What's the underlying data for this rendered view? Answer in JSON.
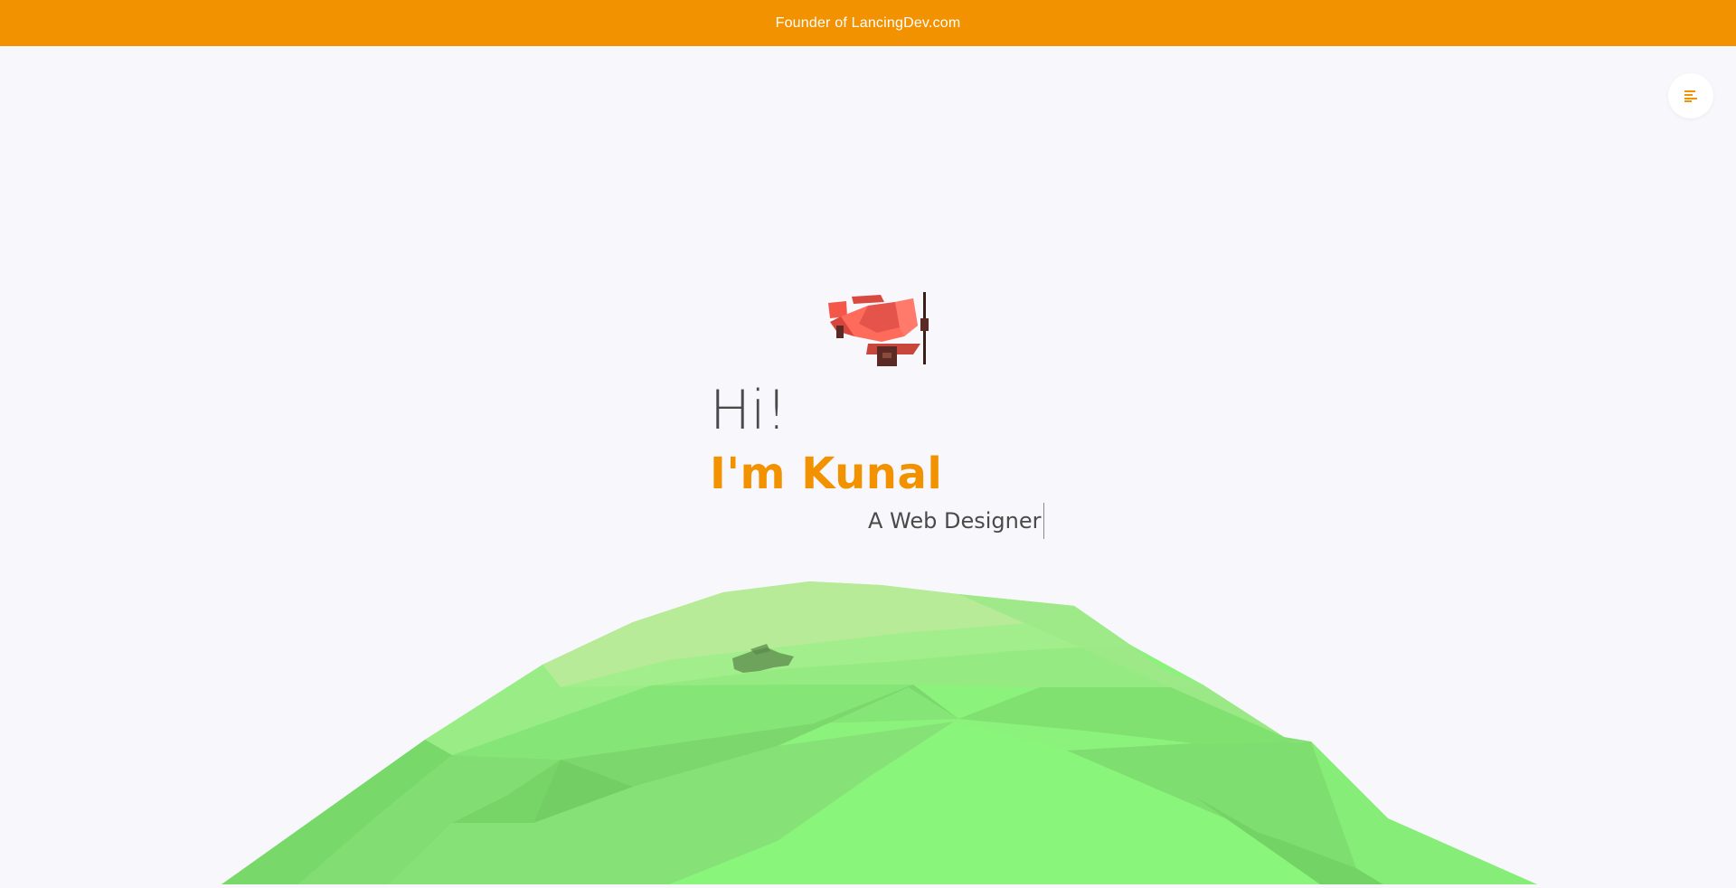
{
  "topbar": {
    "text": "Founder of LancingDev.com",
    "color": "#f39200"
  },
  "menu": {
    "icon": "menu-icon",
    "icon_color": "#f39200"
  },
  "hero": {
    "greeting": "Hi!",
    "name": "I'm Kunal",
    "role": "A Web Designer",
    "name_color": "#f39200"
  },
  "scene": {
    "plane_icon": "red-airplane",
    "planet_color": "#88f07a"
  }
}
